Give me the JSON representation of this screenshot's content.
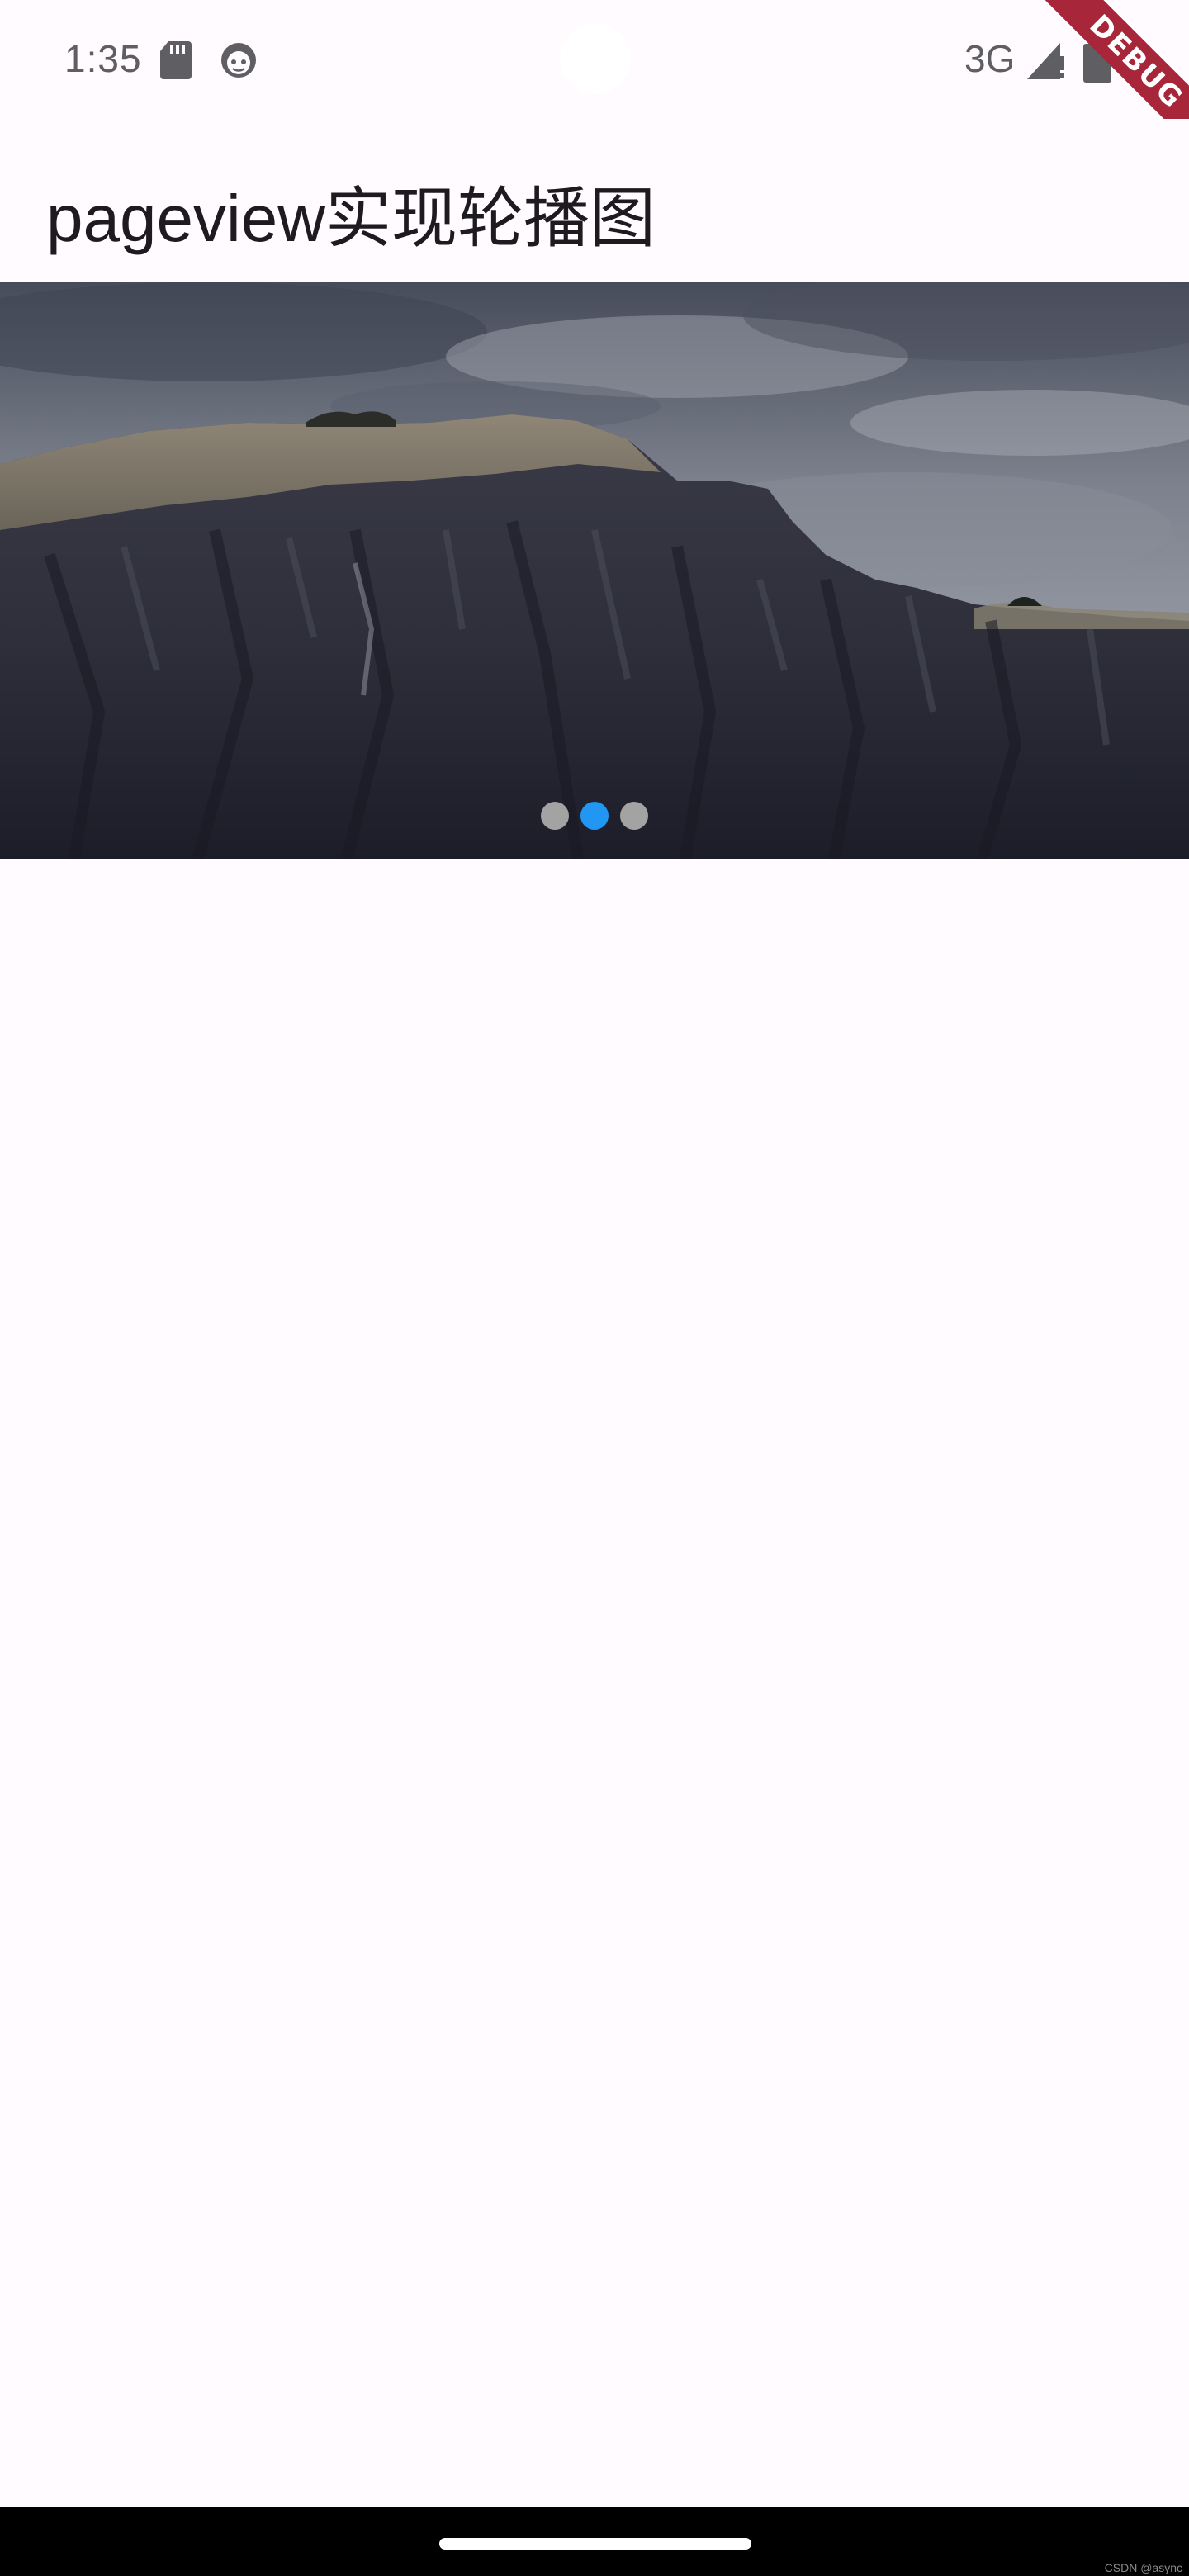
{
  "status_bar": {
    "time": "1:35",
    "network": "3G",
    "icons": [
      "sd-card-icon",
      "android-face-icon",
      "signal-icon",
      "battery-icon"
    ]
  },
  "debug_banner": {
    "label": "DEBUG",
    "color": "#a8263a"
  },
  "app_bar": {
    "title": "pageview实现轮播图"
  },
  "carousel": {
    "image": "mountain-cliff-landscape",
    "page_count": 3,
    "current_page": 2,
    "active_dot_color": "#2196f3",
    "inactive_dot_color": "#a3a3a3"
  },
  "watermark": {
    "text": "CSDN @async"
  },
  "colors": {
    "background": "#fffbff",
    "title_text": "#1d1b20",
    "status_text": "#5f5f63",
    "nav_bar": "#000000"
  }
}
